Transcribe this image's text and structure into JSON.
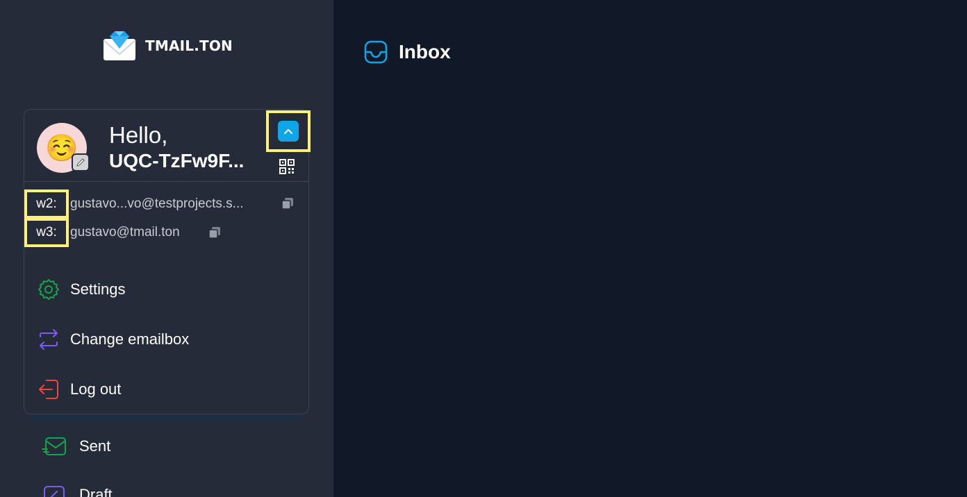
{
  "brand": {
    "name": "TMAIL.TON"
  },
  "profile": {
    "avatar_emoji": "☺️",
    "greeting": "Hello,",
    "address": "UQC-TzFw9F...",
    "emails": [
      {
        "tag": "w2:",
        "value": "gustavo...vo@testprojects.s..."
      },
      {
        "tag": "w3:",
        "value": "gustavo@tmail.ton"
      }
    ]
  },
  "menu": {
    "settings": "Settings",
    "change_emailbox": "Change emailbox",
    "log_out": "Log out"
  },
  "nav": {
    "sent": "Sent",
    "draft": "Draft"
  },
  "main": {
    "title": "Inbox"
  },
  "colors": {
    "accent": "#0ea5e9",
    "highlight": "#fff176",
    "settings_icon": "#16a34a",
    "change_icon": "#7c5cf5",
    "logout_icon": "#ef4444"
  }
}
